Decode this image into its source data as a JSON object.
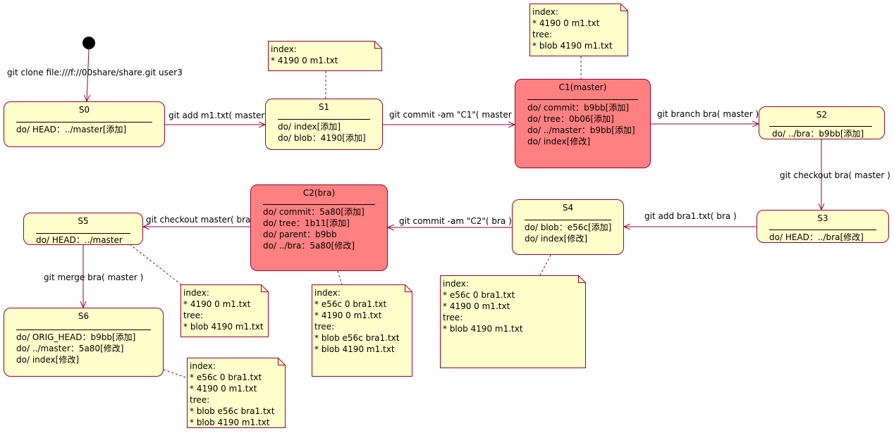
{
  "states": {
    "s0": {
      "name": "S0",
      "actions": [
        "do/ HEAD：../master[添加]"
      ]
    },
    "s1": {
      "name": "S1",
      "actions": [
        "do/ index[添加]",
        "do/ blob：4190[添加]"
      ]
    },
    "c1": {
      "name": "C1(master)",
      "actions": [
        "do/ commit：b9bb[添加]",
        "do/ tree：0b06[添加]",
        "do/ ../master：b9bb[添加]",
        "do/ index[修改]"
      ]
    },
    "s2": {
      "name": "S2",
      "actions": [
        "do/ ../bra：b9bb[添加]"
      ]
    },
    "s3": {
      "name": "S3",
      "actions": [
        "do/ HEAD：../bra[修改]"
      ]
    },
    "s4": {
      "name": "S4",
      "actions": [
        "do/ blob：e56c[添加]",
        "do/ index[修改]"
      ]
    },
    "c2": {
      "name": "C2(bra)",
      "actions": [
        "do/ commit：5a80[添加]",
        "do/ tree：1b11[添加]",
        "do/ parent：b9bb",
        "do/ ../bra：5a80[修改]"
      ]
    },
    "s5": {
      "name": "S5",
      "actions": [
        "do/ HEAD：../master"
      ]
    },
    "s6": {
      "name": "S6",
      "actions": [
        "do/ ORIG_HEAD：b9bb[添加]",
        "do/ ../master：5a80[修改]",
        "do/ index[修改]"
      ]
    }
  },
  "transitions": {
    "t_clone": "git clone file:///f://00share/share.git user3",
    "t_add": "git add m1.txt( master )",
    "t_commit1": "git commit -am \"C1\"( master )",
    "t_branch": "git branch bra( master )",
    "t_checkout_bra": "git checkout bra( master )",
    "t_add_bra1": "git add bra1.txt( bra )",
    "t_commit2": "git commit -am \"C2\"( bra )",
    "t_checkout_master": "git checkout master( bra )",
    "t_merge": "git merge bra( master )"
  },
  "notes": {
    "n_s1": [
      "index:",
      "* 4190 0 m1.txt"
    ],
    "n_c1": [
      "index:",
      "* 4190 0 m1.txt",
      "tree:",
      "* blob 4190 m1.txt"
    ],
    "n_s4": [
      "index:",
      "* e56c 0 bra1.txt",
      "* 4190 0 m1.txt",
      "tree:",
      "* blob 4190 m1.txt"
    ],
    "n_c2": [
      "index:",
      "* e56c 0 bra1.txt",
      "* 4190 0 m1.txt",
      "tree:",
      "* blob e56c bra1.txt",
      "* blob 4190 m1.txt"
    ],
    "n_s5": [
      "index:",
      "* 4190 0 m1.txt",
      "tree:",
      "* blob 4190 m1.txt"
    ],
    "n_s6": [
      "index:",
      "* e56c 0 bra1.txt",
      "* 4190 0 m1.txt",
      "tree:",
      "* blob e56c bra1.txt",
      "* blob 4190 m1.txt"
    ]
  },
  "colors": {
    "state_fill": "#ffffcc",
    "commit_fill": "#ff8080",
    "border": "#990033",
    "note_fill": "#ffffcc"
  }
}
